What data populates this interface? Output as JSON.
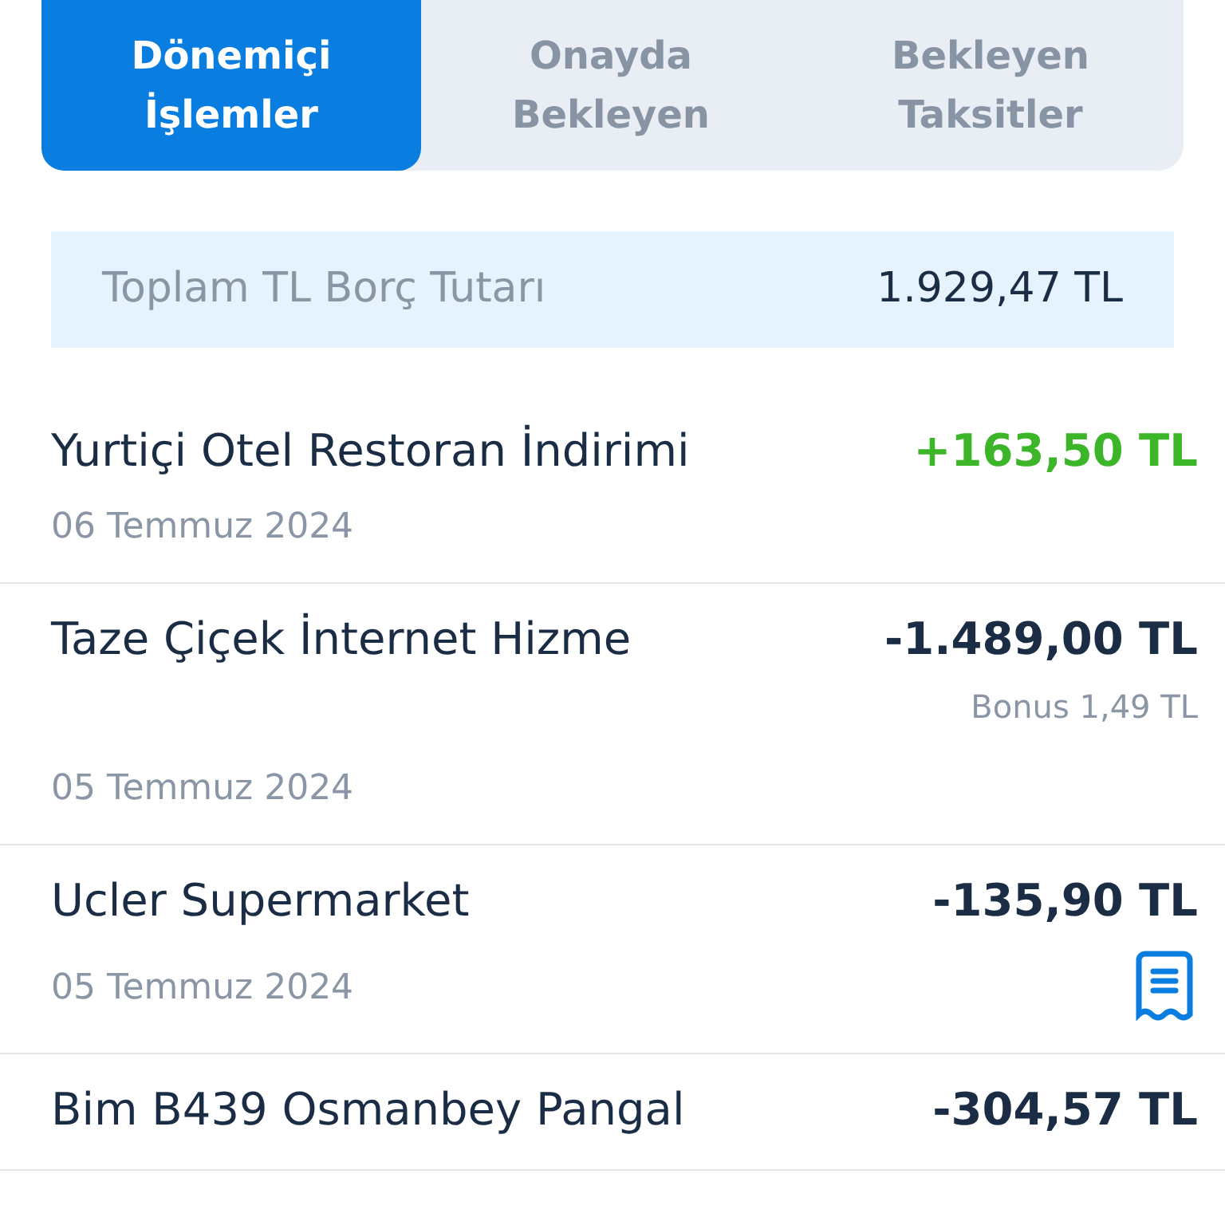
{
  "tabs": [
    {
      "label": "Dönemiçi İşlemler",
      "selected": true
    },
    {
      "label": "Onayda Bekleyen",
      "selected": false
    },
    {
      "label": "Bekleyen Taksitler",
      "selected": false
    }
  ],
  "total": {
    "label": "Toplam TL Borç Tutarı",
    "amount": "1.929,47 TL"
  },
  "transactions": [
    {
      "name": "Yurtiçi Otel Restoran İndirimi",
      "amount": "+163,50 TL",
      "kind": "credit",
      "date": "06 Temmuz 2024",
      "receipt": false
    },
    {
      "name": "Taze Çiçek İnternet Hizme",
      "amount": "-1.489,00 TL",
      "kind": "debit",
      "bonus": "Bonus 1,49 TL",
      "date": "05 Temmuz 2024",
      "receipt": false
    },
    {
      "name": "Ucler Supermarket",
      "amount": "-135,90 TL",
      "kind": "debit",
      "date": "05 Temmuz 2024",
      "receipt": true
    },
    {
      "name": "Bim B439 Osmanbey Pangal",
      "amount": "-304,57 TL",
      "kind": "debit",
      "receipt": false
    }
  ]
}
